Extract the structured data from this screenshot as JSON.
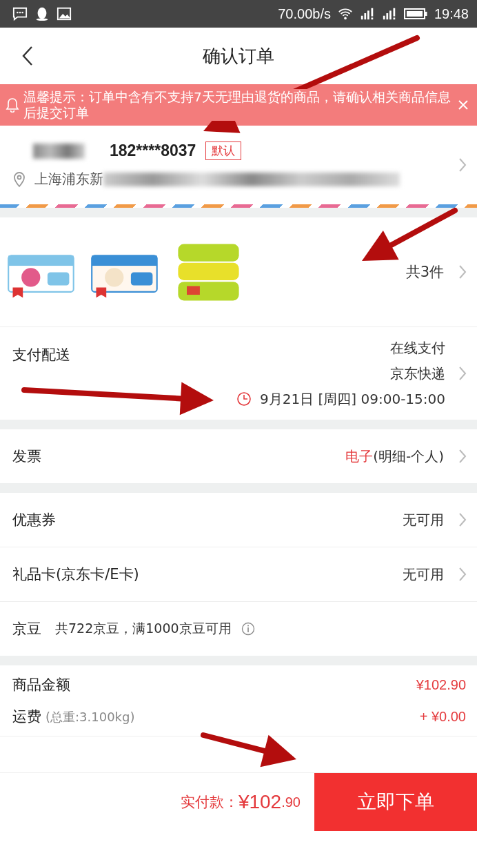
{
  "status_bar": {
    "speed": "70.00b/s",
    "time": "19:48"
  },
  "header": {
    "title": "确认订单"
  },
  "notice": {
    "text": "温馨提示：订单中含有不支持7天无理由退货的商品，请确认相关商品信息后提交订单"
  },
  "address": {
    "phone": "182****8037",
    "tag": "默认",
    "address": "上海浦东新"
  },
  "products": {
    "count": "共3件"
  },
  "delivery": {
    "label": "支付配送",
    "payment": "在线支付",
    "courier": "京东快递",
    "time": "9月21日 [周四] 09:00-15:00"
  },
  "invoice": {
    "label": "发票",
    "type": "电子",
    "detail": "(明细-个人)"
  },
  "discounts": [
    {
      "label": "优惠券",
      "value": "无可用",
      "kind": "link"
    },
    {
      "label": "礼品卡(京东卡/E卡)",
      "value": "无可用",
      "kind": "link"
    },
    {
      "label": "京豆",
      "value": "共722京豆，满1000京豆可用",
      "kind": "info"
    }
  ],
  "amounts": [
    {
      "label": "商品金额",
      "value": "¥102.90"
    },
    {
      "label": "运费",
      "note": "(总重:3.100kg)",
      "value": "+ ¥0.00"
    }
  ],
  "footer": {
    "label": "实付款：",
    "amount": "¥102",
    "cents": ".90",
    "button": "立即下单"
  }
}
